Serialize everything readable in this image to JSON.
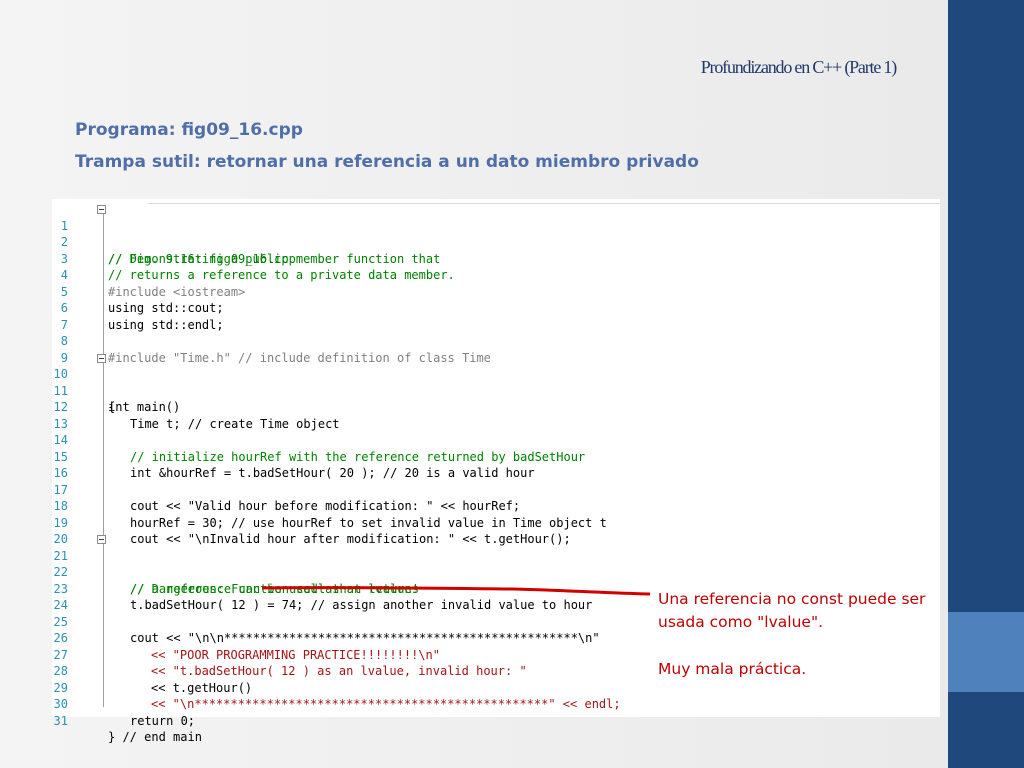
{
  "slide": {
    "title": "Profundizando en C++ (Parte 1)",
    "subtitle1": "Programa: fig09_16.cpp",
    "subtitle2": "Trampa sutil: retornar una referencia a un dato miembro privado"
  },
  "code": {
    "lines": [
      {
        "n": "1",
        "text": "// Fig. 9.16: fig09_16.cpp"
      },
      {
        "n": "2",
        "text": "// Demonstrating a public member function that"
      },
      {
        "n": "3",
        "text": "// returns a reference to a private data member."
      },
      {
        "n": "4",
        "text": "#include <iostream>"
      },
      {
        "n": "5",
        "text": "using std::cout;"
      },
      {
        "n": "6",
        "text": "using std::endl;"
      },
      {
        "n": "7",
        "text": ""
      },
      {
        "n": "8",
        "text": "#include \"Time.h\" // include definition of class Time"
      },
      {
        "n": "9",
        "text": ""
      },
      {
        "n": "10",
        "text": "int main()"
      },
      {
        "n": "11",
        "text": "{"
      },
      {
        "n": "12",
        "text": "Time t; // create Time object"
      },
      {
        "n": "13",
        "text": ""
      },
      {
        "n": "14",
        "text": "// initialize hourRef with the reference returned by badSetHour"
      },
      {
        "n": "15",
        "text": "int &hourRef = t.badSetHour( 20 ); // 20 is a valid hour"
      },
      {
        "n": "16",
        "text": ""
      },
      {
        "n": "17",
        "text": "cout << \"Valid hour before modification: \" << hourRef;"
      },
      {
        "n": "18",
        "text": "hourRef = 30; // use hourRef to set invalid value in Time object t"
      },
      {
        "n": "19",
        "text": "cout << \"\\nInvalid hour after modification: \" << t.getHour();"
      },
      {
        "n": "20",
        "text": ""
      },
      {
        "n": "21",
        "text": "// Dangerous: Function call that returns"
      },
      {
        "n": "22",
        "text": "// a reference can be used as an lvalue!"
      },
      {
        "n": "23",
        "text": "t.badSetHour( 12 ) = 74; // assign another invalid value to hour"
      },
      {
        "n": "24",
        "text": ""
      },
      {
        "n": "25",
        "text": "cout << \"\\n\\n*************************************************\\n\""
      },
      {
        "n": "26",
        "text": "<< \"POOR PROGRAMMING PRACTICE!!!!!!!!\\n\""
      },
      {
        "n": "27",
        "text": "<< \"t.badSetHour( 12 ) as an lvalue, invalid hour: \""
      },
      {
        "n": "28",
        "text": "<< t.getHour()"
      },
      {
        "n": "29",
        "text": "<< \"\\n*************************************************\" << endl;"
      },
      {
        "n": "30",
        "text": "return 0;"
      },
      {
        "n": "31",
        "text": "} // end main"
      }
    ]
  },
  "annotation": {
    "line1": "Una referencia no const puede ser",
    "line2": "usada como \"lvalue\".",
    "line3": "Muy mala práctica."
  },
  "colors": {
    "side_band": "#1f497d",
    "side_accent": "#4f81bd",
    "subtitle": "#4f6fa8",
    "annotation": "#c00000",
    "comment": "#008000",
    "keyword": "#0000ff",
    "string": "#a31515",
    "line_number": "#2b91af"
  }
}
